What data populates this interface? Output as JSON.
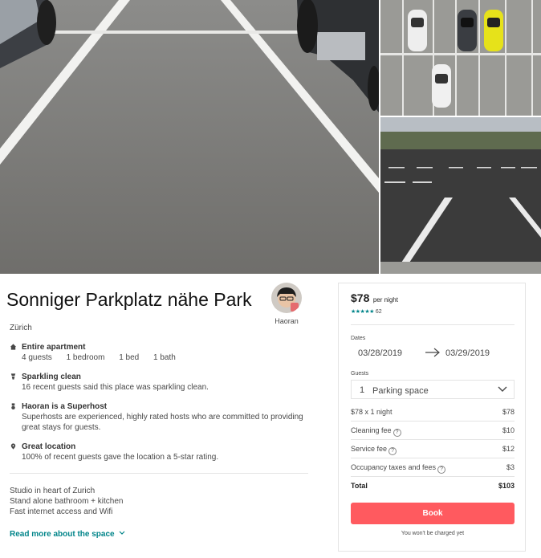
{
  "listing": {
    "title": "Sonniger Parkplatz nähe Park",
    "city": "Zürich",
    "host_name": "Haoran"
  },
  "highlights": [
    {
      "icon": "home-icon",
      "title": "Entire apartment",
      "specs": [
        "4 guests",
        "1 bedroom",
        "1 bed",
        "1 bath"
      ]
    },
    {
      "icon": "sparkle-icon",
      "title": "Sparkling clean",
      "text": "16 recent guests said this place was sparkling clean."
    },
    {
      "icon": "medal-icon",
      "title": "Haoran is a Superhost",
      "text": "Superhosts are experienced, highly rated hosts who are committed to providing great stays for guests."
    },
    {
      "icon": "location-pin-icon",
      "title": "Great location",
      "text": "100% of recent guests gave the location a 5-star rating."
    }
  ],
  "description": {
    "lines": [
      "Studio in heart of Zurich",
      "Stand alone bathroom + kitchen",
      "Fast internet access and Wifi"
    ],
    "read_more": "Read more about the space"
  },
  "booking": {
    "price": "$78",
    "per": "per night",
    "stars": "★★★★★",
    "reviews": "62",
    "dates_label": "Dates",
    "check_in": "03/28/2019",
    "check_out": "03/29/2019",
    "guests_label": "Guests",
    "guests_count": "1",
    "guests_value": "Parking space",
    "rows": [
      {
        "label": "$78 x 1 night",
        "amount": "$78"
      },
      {
        "label": "Cleaning fee",
        "amount": "$10"
      },
      {
        "label": "Service fee",
        "amount": "$12"
      },
      {
        "label": "Occupancy taxes and fees",
        "amount": "$3"
      }
    ],
    "total_label": "Total",
    "total_amount": "$103",
    "book_label": "Book",
    "note": "You won't be charged yet"
  },
  "colors": {
    "accent": "#ff5a5f",
    "teal": "#008489",
    "text": "#484848"
  }
}
